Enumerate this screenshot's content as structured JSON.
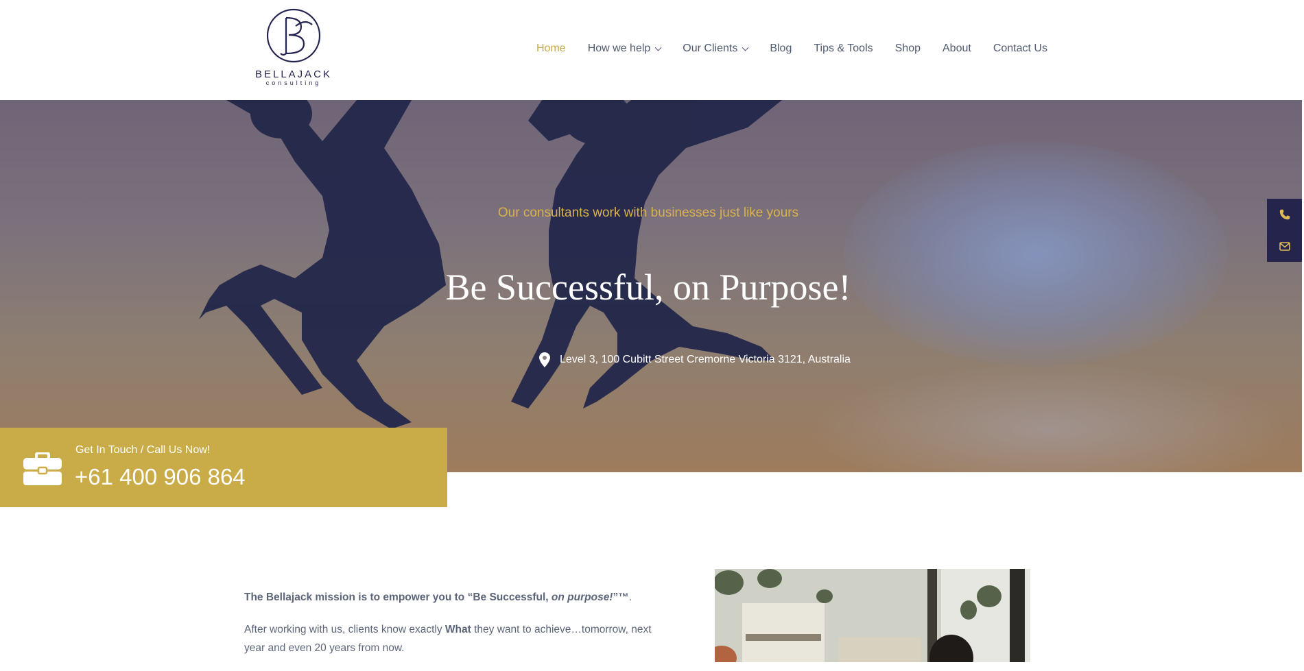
{
  "logo": {
    "word": "BELLAJACK",
    "sub": "consulting"
  },
  "nav": {
    "items": [
      {
        "label": "Home",
        "active": true,
        "dropdown": false
      },
      {
        "label": "How we help",
        "active": false,
        "dropdown": true
      },
      {
        "label": "Our Clients",
        "active": false,
        "dropdown": true
      },
      {
        "label": "Blog",
        "active": false,
        "dropdown": false
      },
      {
        "label": "Tips & Tools",
        "active": false,
        "dropdown": false
      },
      {
        "label": "Shop",
        "active": false,
        "dropdown": false
      },
      {
        "label": "About",
        "active": false,
        "dropdown": false
      },
      {
        "label": "Contact Us",
        "active": false,
        "dropdown": false
      }
    ]
  },
  "hero": {
    "tagline": "Our consultants work with businesses just like yours",
    "title": "Be Successful, on Purpose!",
    "address": "Level 3, 100 Cubitt Street Cremorne Victoria 3121, Australia"
  },
  "side_contact": {
    "icons": [
      "phone-icon",
      "envelope-icon"
    ]
  },
  "callbox": {
    "label": "Get In Touch / Call Us Now!",
    "phone": "+61 400 906 864",
    "icon": "briefcase-icon"
  },
  "mission": {
    "line1_prefix": "The Bellajack mission is to empower you to “Be Successful, ",
    "line1_em": "on purpose!",
    "line1_suffix": "”™",
    "line1_end": ".",
    "line2_prefix": "After working with us, clients know exactly ",
    "line2_bold": "What",
    "line2_suffix": " they want to achieve…tomorrow, next year and even 20 years from now."
  },
  "colors": {
    "gold": "#c9ab48",
    "navy": "#24244d",
    "text": "#5c6578"
  }
}
